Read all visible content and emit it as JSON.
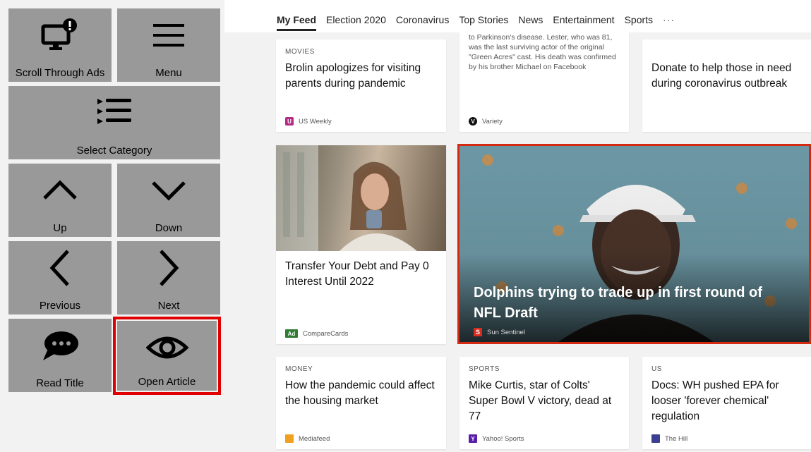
{
  "controls": {
    "scroll_ads": "Scroll Through Ads",
    "menu": "Menu",
    "select_category": "Select Category",
    "up": "Up",
    "down": "Down",
    "previous": "Previous",
    "next": "Next",
    "read_title": "Read Title",
    "open_article": "Open Article"
  },
  "nav": {
    "tabs": [
      "My Feed",
      "Election 2020",
      "Coronavirus",
      "Top Stories",
      "News",
      "Entertainment",
      "Sports"
    ],
    "more": "···"
  },
  "cards": {
    "brolin": {
      "category": "MOVIES",
      "title": "Brolin apologizes for visiting parents during pandemic",
      "source": "US Weekly"
    },
    "variety": {
      "snippet": "to Parkinson's disease. Lester, who was 81, was the last surviving actor of the original \"Green Acres\" cast. His death was confirmed by his brother Michael on Facebook",
      "source": "Variety"
    },
    "donate": {
      "title": "Donate to help those in need during coronavirus outbreak"
    },
    "ad": {
      "title": "Transfer Your Debt and Pay 0 Interest Until 2022",
      "badge": "Ad",
      "source": "CompareCards"
    },
    "hero": {
      "title": "Dolphins trying to trade up in first round of NFL Draft",
      "source": "Sun Sentinel"
    },
    "money": {
      "category": "MONEY",
      "title": "How the pandemic could affect the housing market",
      "source": "Mediafeed"
    },
    "sports": {
      "category": "SPORTS",
      "title": "Mike Curtis, star of Colts' Super Bowl V victory, dead at 77",
      "source": "Yahoo! Sports"
    },
    "us": {
      "category": "US",
      "title": "Docs: WH pushed EPA for looser 'forever chemical' regulation",
      "source": "The Hill"
    }
  },
  "colors": {
    "control_bg": "#999999",
    "selection": "#e00000",
    "hero_border": "#d42a12"
  }
}
